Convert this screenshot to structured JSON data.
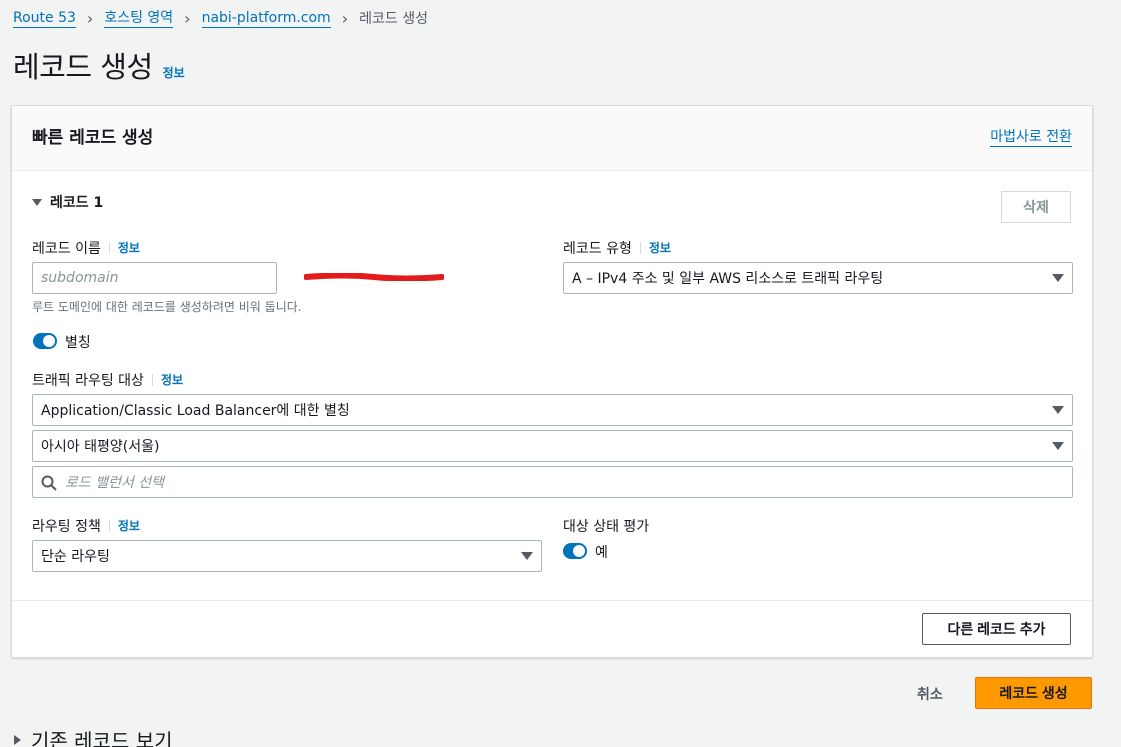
{
  "breadcrumb": {
    "items": [
      "Route 53",
      "호스팅 영역",
      "nabi-platform.com"
    ],
    "current": "레코드 생성"
  },
  "page": {
    "title": "레코드 생성",
    "info": "정보"
  },
  "panel": {
    "title": "빠른 레코드 생성",
    "wizard_link": "마법사로 전환",
    "record_header": "레코드 1",
    "delete_label": "삭제",
    "record_name": {
      "label": "레코드 이름",
      "info": "정보",
      "placeholder": "subdomain",
      "helper": "루트 도메인에 대한 레코드를 생성하려면 비워 둡니다."
    },
    "record_type": {
      "label": "레코드 유형",
      "info": "정보",
      "value": "A – IPv4 주소 및 일부 AWS 리소스로 트래픽 라우팅"
    },
    "alias": {
      "label": "별칭",
      "enabled": true
    },
    "route_target": {
      "label": "트래픽 라우팅 대상",
      "info": "정보",
      "endpoint_type": "Application/Classic Load Balancer에 대한 별칭",
      "region": "아시아 태평양(서울)",
      "lb_placeholder": "로드 밸런서 선택"
    },
    "routing_policy": {
      "label": "라우팅 정책",
      "info": "정보",
      "value": "단순 라우팅"
    },
    "health_eval": {
      "label": "대상 상태 평가",
      "toggle_label": "예",
      "enabled": true
    },
    "add_record_label": "다른 레코드 추가"
  },
  "actions": {
    "cancel": "취소",
    "create": "레코드 생성"
  },
  "existing": {
    "title": "기존 레코드 보기"
  },
  "colors": {
    "link": "#0073bb",
    "primary": "#ff9900",
    "toggle": "#0073bb",
    "redaction": "#e31b1b"
  }
}
